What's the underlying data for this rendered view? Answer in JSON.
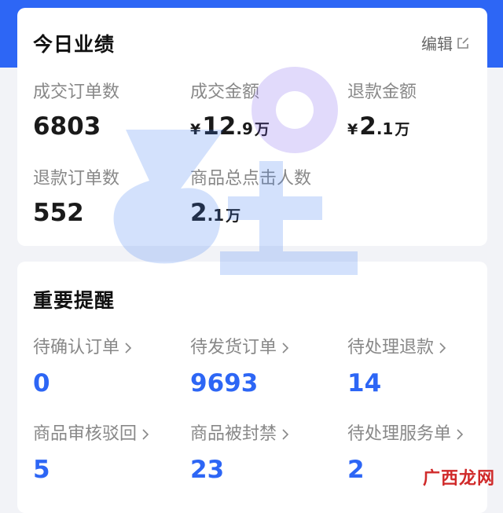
{
  "performance": {
    "title": "今日业绩",
    "edit_label": "编辑",
    "metrics": [
      {
        "label": "成交订单数",
        "int": "6803",
        "currency": "",
        "decimal": "",
        "unit": ""
      },
      {
        "label": "成交金额",
        "currency": "¥",
        "int": "12",
        "decimal": ".9",
        "unit": "万"
      },
      {
        "label": "退款金额",
        "currency": "¥",
        "int": "2",
        "decimal": ".1",
        "unit": "万"
      },
      {
        "label": "退款订单数",
        "int": "552",
        "currency": "",
        "decimal": "",
        "unit": ""
      },
      {
        "label": "商品总点击人数",
        "currency": "",
        "int": "2",
        "decimal": ".1",
        "unit": "万"
      }
    ]
  },
  "reminders": {
    "title": "重要提醒",
    "items": [
      {
        "label": "待确认订单",
        "value": "0"
      },
      {
        "label": "待发货订单",
        "value": "9693"
      },
      {
        "label": "待处理退款",
        "value": "14"
      },
      {
        "label": "商品审核驳回",
        "value": "5"
      },
      {
        "label": "商品被封禁",
        "value": "23"
      },
      {
        "label": "待处理服务单",
        "value": "2"
      }
    ]
  },
  "site_mark": "广西龙网",
  "colors": {
    "accent": "#2d66f5",
    "background": "#f2f3f7",
    "card": "#ffffff",
    "label": "#888888",
    "value": "#1a1a1a"
  },
  "icons": {
    "edit": "edit-icon",
    "chevron": "chevron-right-icon"
  }
}
